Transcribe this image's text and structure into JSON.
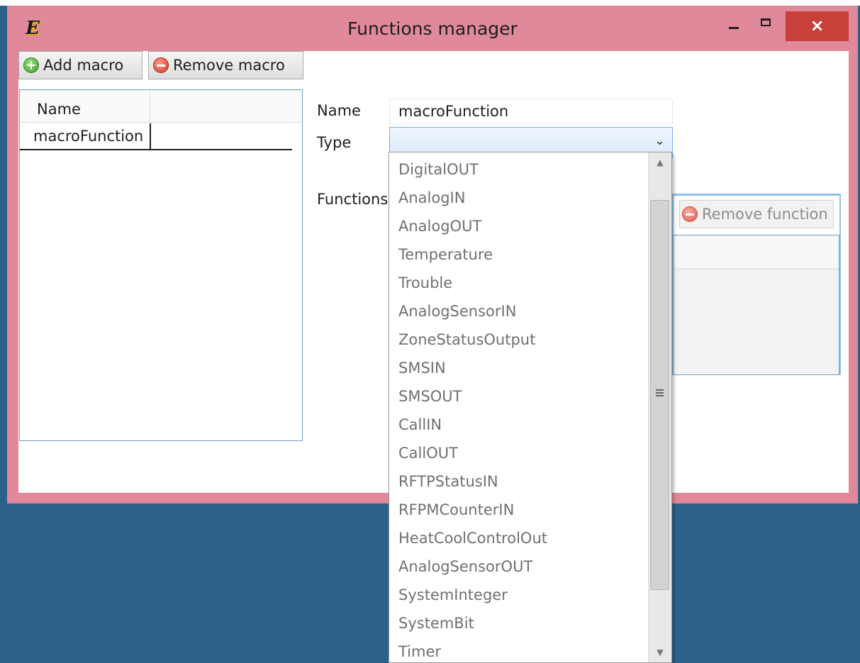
{
  "window": {
    "title": "Functions manager",
    "app_icon": "E",
    "controls": {
      "minimize": "minimize-icon",
      "maximize": "maximize-icon",
      "close": "×"
    }
  },
  "toolbar": {
    "add_macro": "Add macro",
    "remove_macro": "Remove macro"
  },
  "macro_list": {
    "header": "Name",
    "rows": [
      "macroFunction"
    ]
  },
  "form": {
    "name_label": "Name",
    "name_value": "macroFunction",
    "type_label": "Type",
    "type_value": "",
    "functions_label": "Functions",
    "remove_function": "Remove function"
  },
  "type_options": [
    "DigitalOUT",
    "AnalogIN",
    "AnalogOUT",
    "Temperature",
    "Trouble",
    "AnalogSensorIN",
    "ZoneStatusOutput",
    "SMSIN",
    "SMSOUT",
    "CallIN",
    "CallOUT",
    "RFTPStatusIN",
    "RFPMCounterIN",
    "HeatCoolControlOut",
    "AnalogSensorOUT",
    "SystemInteger",
    "SystemBit",
    "Timer"
  ],
  "colors": {
    "titlebar": "#e0899a",
    "desktop": "#2d6089",
    "close_button": "#c8403a",
    "accent_border": "#6e9ccb"
  }
}
